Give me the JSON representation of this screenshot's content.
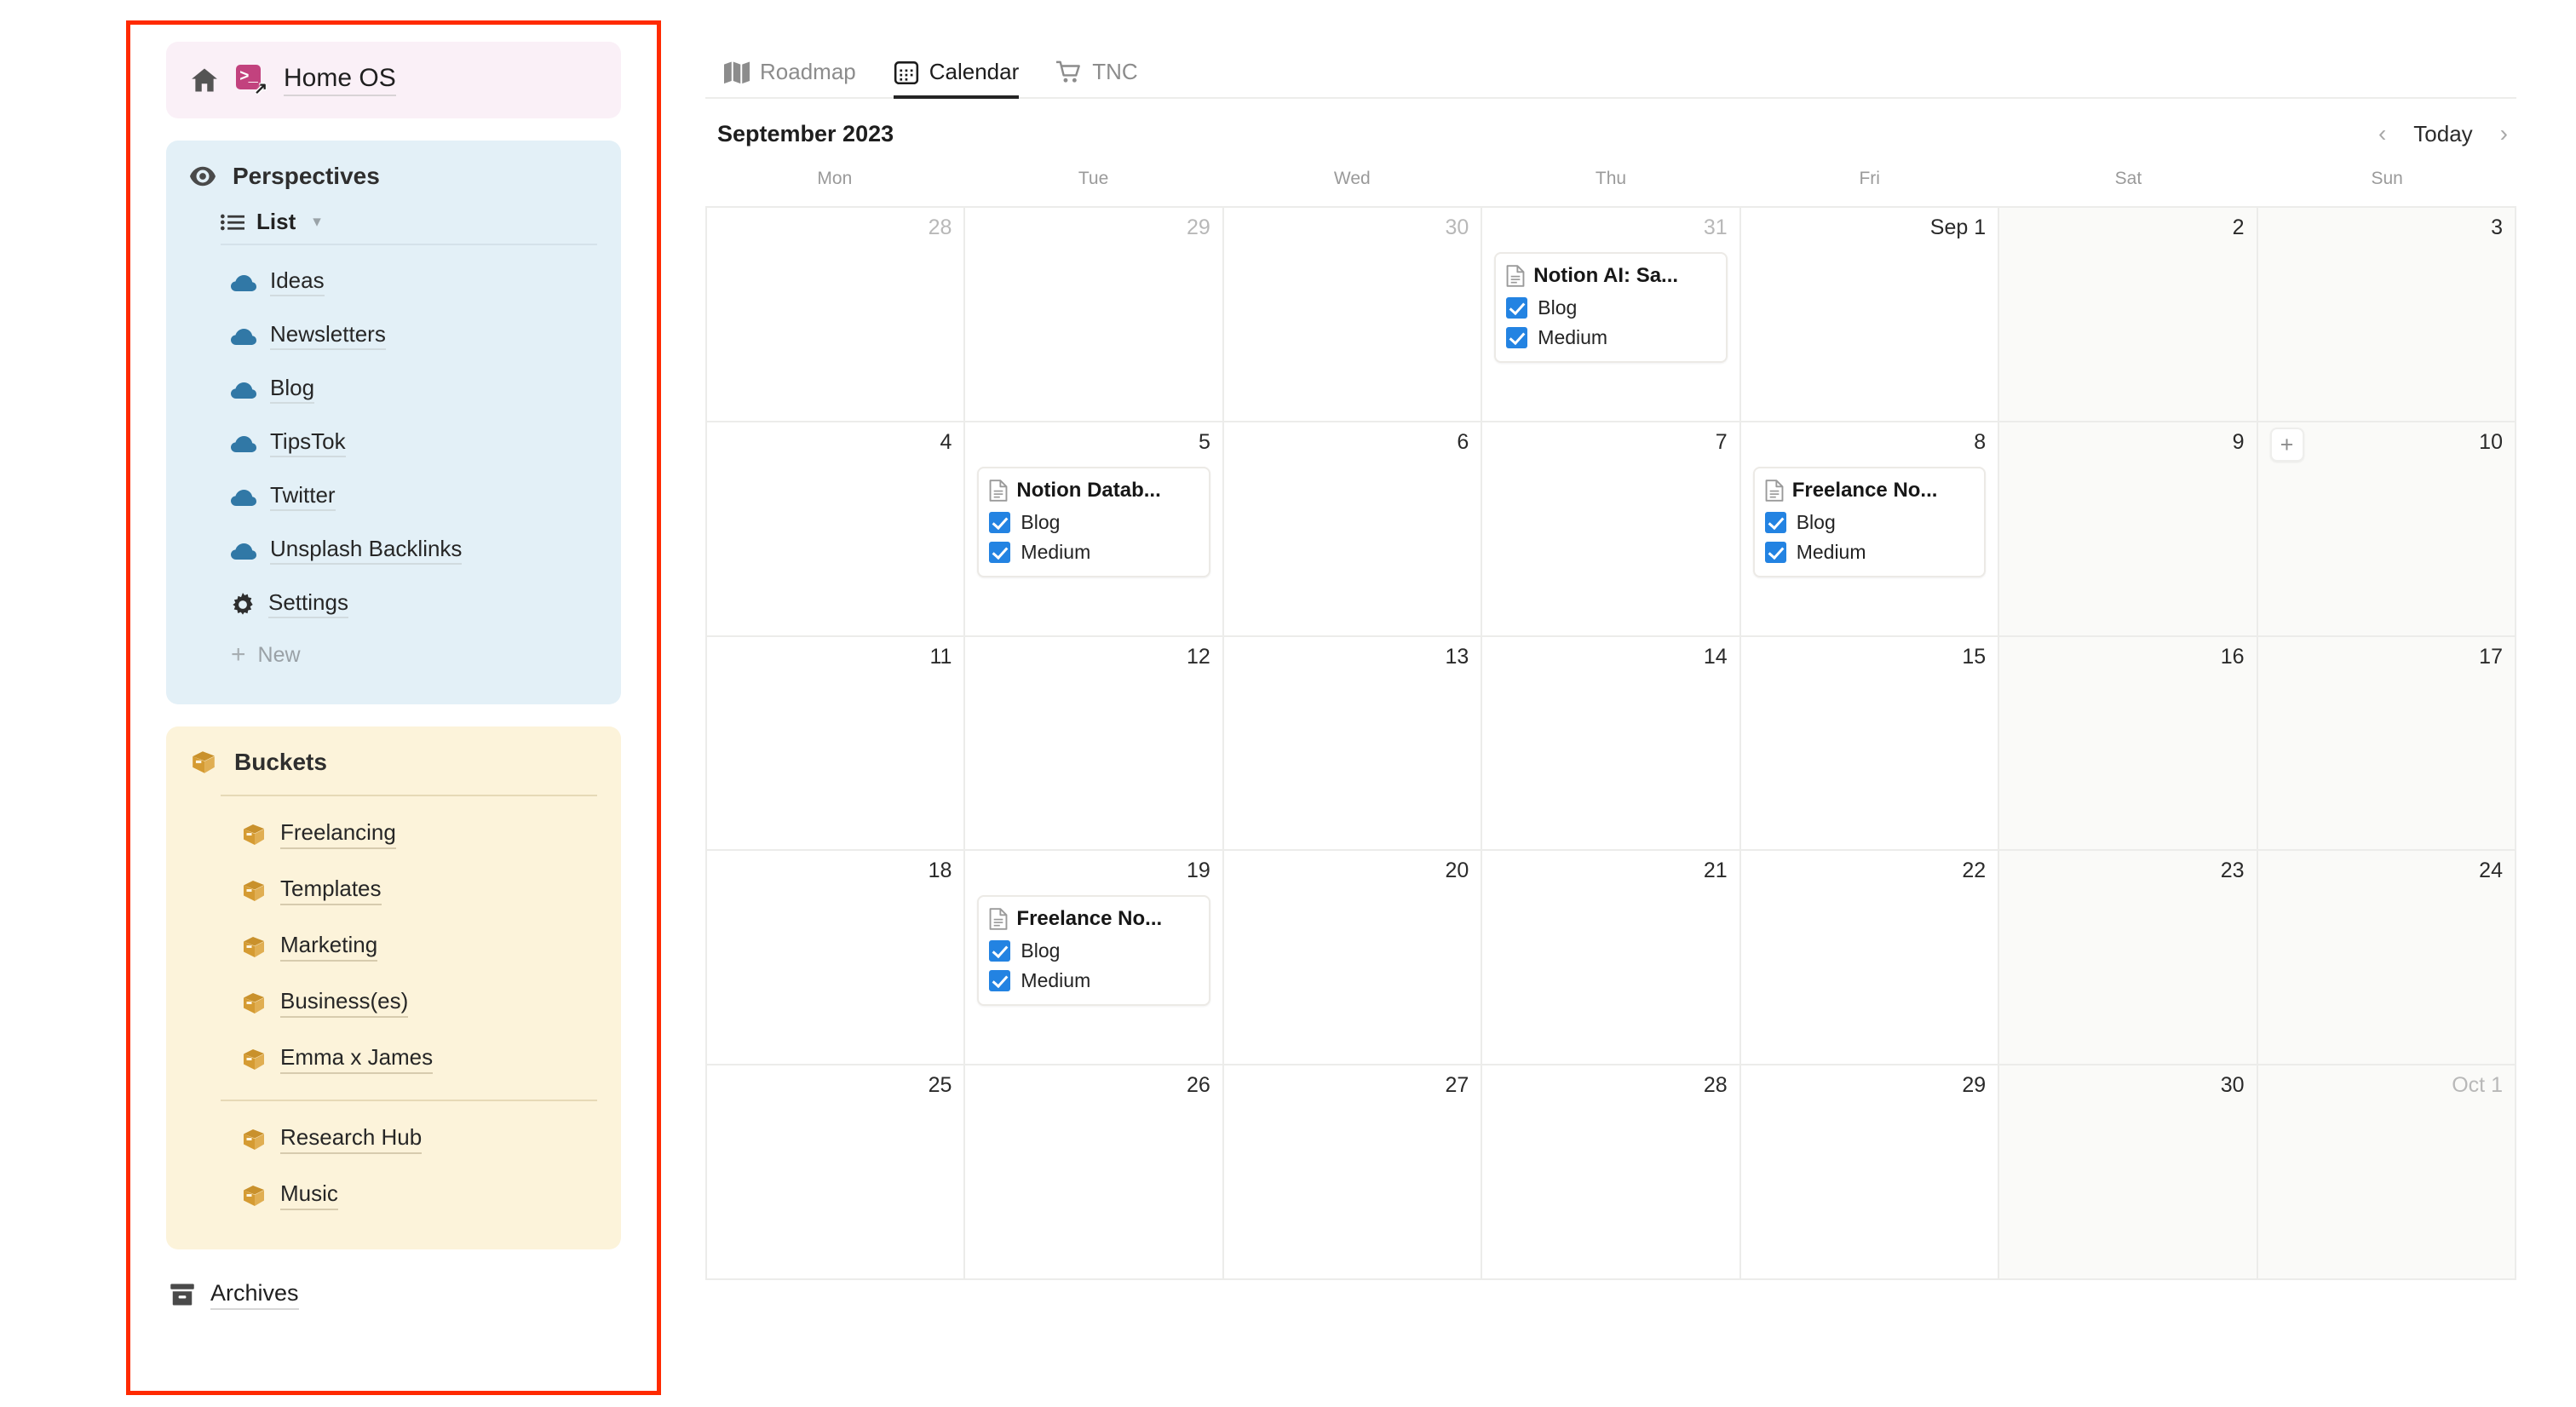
{
  "sidebar": {
    "home": {
      "home_icon": "home-icon",
      "badge_glyph": ">_",
      "label": "Home OS"
    },
    "perspectives": {
      "icon": "eye-icon",
      "title": "Perspectives",
      "view": {
        "icon": "list-icon",
        "label": "List",
        "chevron": "⌄"
      },
      "items": [
        {
          "icon": "cloud-icon",
          "label": "Ideas"
        },
        {
          "icon": "cloud-icon",
          "label": "Newsletters"
        },
        {
          "icon": "cloud-icon",
          "label": "Blog"
        },
        {
          "icon": "cloud-icon",
          "label": "TipsTok"
        },
        {
          "icon": "cloud-icon",
          "label": "Twitter"
        },
        {
          "icon": "cloud-icon",
          "label": "Unsplash Backlinks"
        },
        {
          "icon": "gear-icon",
          "label": "Settings"
        }
      ],
      "new_label": "New",
      "new_icon": "plus-icon"
    },
    "buckets": {
      "icon": "package-icon",
      "title": "Buckets",
      "group_one": [
        {
          "icon": "package-icon",
          "label": "Freelancing"
        },
        {
          "icon": "package-icon",
          "label": "Templates"
        },
        {
          "icon": "package-icon",
          "label": "Marketing"
        },
        {
          "icon": "package-icon",
          "label": "Business(es)"
        },
        {
          "icon": "package-icon",
          "label": "Emma x James"
        }
      ],
      "group_two": [
        {
          "icon": "package-icon",
          "label": "Research Hub"
        },
        {
          "icon": "package-icon",
          "label": "Music"
        }
      ]
    },
    "archives": {
      "icon": "archive-icon",
      "label": "Archives"
    }
  },
  "main": {
    "tabs": [
      {
        "icon": "map-icon",
        "label": "Roadmap",
        "active": false
      },
      {
        "icon": "calendar-icon",
        "label": "Calendar",
        "active": true
      },
      {
        "icon": "cart-icon",
        "label": "TNC",
        "active": false
      }
    ],
    "calendar": {
      "title": "September 2023",
      "prev_label": "‹",
      "today_label": "Today",
      "next_label": "›",
      "day_headers": [
        "Mon",
        "Tue",
        "Wed",
        "Thu",
        "Fri",
        "Sat",
        "Sun"
      ],
      "add_button_label": "+",
      "weeks": [
        [
          {
            "day": "28",
            "muted": true,
            "weekend": false
          },
          {
            "day": "29",
            "muted": true,
            "weekend": false
          },
          {
            "day": "30",
            "muted": true,
            "weekend": false
          },
          {
            "day": "31",
            "muted": true,
            "weekend": false,
            "event": {
              "icon": "document-icon",
              "title": "Notion AI: Sa...",
              "props": [
                {
                  "label": "Blog",
                  "checked": true
                },
                {
                  "label": "Medium",
                  "checked": true
                }
              ]
            }
          },
          {
            "day": "Sep 1",
            "muted": false,
            "weekend": false
          },
          {
            "day": "2",
            "muted": false,
            "weekend": true
          },
          {
            "day": "3",
            "muted": false,
            "weekend": true
          }
        ],
        [
          {
            "day": "4",
            "muted": false,
            "weekend": false
          },
          {
            "day": "5",
            "muted": false,
            "weekend": false,
            "event": {
              "icon": "document-icon",
              "title": "Notion Datab...",
              "props": [
                {
                  "label": "Blog",
                  "checked": true
                },
                {
                  "label": "Medium",
                  "checked": true
                }
              ]
            }
          },
          {
            "day": "6",
            "muted": false,
            "weekend": false
          },
          {
            "day": "7",
            "muted": false,
            "weekend": false
          },
          {
            "day": "8",
            "muted": false,
            "weekend": false,
            "event": {
              "icon": "document-icon",
              "title": "Freelance No...",
              "props": [
                {
                  "label": "Blog",
                  "checked": true
                },
                {
                  "label": "Medium",
                  "checked": true
                }
              ]
            }
          },
          {
            "day": "9",
            "muted": false,
            "weekend": true
          },
          {
            "day": "10",
            "muted": false,
            "weekend": true,
            "add_button": true
          }
        ],
        [
          {
            "day": "11",
            "muted": false,
            "weekend": false
          },
          {
            "day": "12",
            "muted": false,
            "weekend": false
          },
          {
            "day": "13",
            "muted": false,
            "weekend": false
          },
          {
            "day": "14",
            "muted": false,
            "weekend": false
          },
          {
            "day": "15",
            "muted": false,
            "weekend": false
          },
          {
            "day": "16",
            "muted": false,
            "weekend": true
          },
          {
            "day": "17",
            "muted": false,
            "weekend": true
          }
        ],
        [
          {
            "day": "18",
            "muted": false,
            "weekend": false
          },
          {
            "day": "19",
            "muted": false,
            "weekend": false,
            "event": {
              "icon": "document-icon",
              "title": "Freelance No...",
              "props": [
                {
                  "label": "Blog",
                  "checked": true
                },
                {
                  "label": "Medium",
                  "checked": true
                }
              ]
            }
          },
          {
            "day": "20",
            "muted": false,
            "weekend": false
          },
          {
            "day": "21",
            "muted": false,
            "weekend": false
          },
          {
            "day": "22",
            "muted": false,
            "weekend": false
          },
          {
            "day": "23",
            "muted": false,
            "weekend": true
          },
          {
            "day": "24",
            "muted": false,
            "weekend": true
          }
        ],
        [
          {
            "day": "25",
            "muted": false,
            "weekend": false
          },
          {
            "day": "26",
            "muted": false,
            "weekend": false
          },
          {
            "day": "27",
            "muted": false,
            "weekend": false
          },
          {
            "day": "28",
            "muted": false,
            "weekend": false
          },
          {
            "day": "29",
            "muted": false,
            "weekend": false
          },
          {
            "day": "30",
            "muted": false,
            "weekend": true
          },
          {
            "day": "Oct 1",
            "muted": true,
            "weekend": true
          }
        ]
      ]
    }
  },
  "colors": {
    "homeos_bg": "#faf0f7",
    "perspectives_bg": "#e3f0f7",
    "buckets_bg": "#fcf3da",
    "cloud_icon": "#3178a6",
    "package_icon": "#d59b32",
    "notion_badge": "#c2427e",
    "checkbox": "#2383e2",
    "annotation_outline": "#ff2a00"
  }
}
